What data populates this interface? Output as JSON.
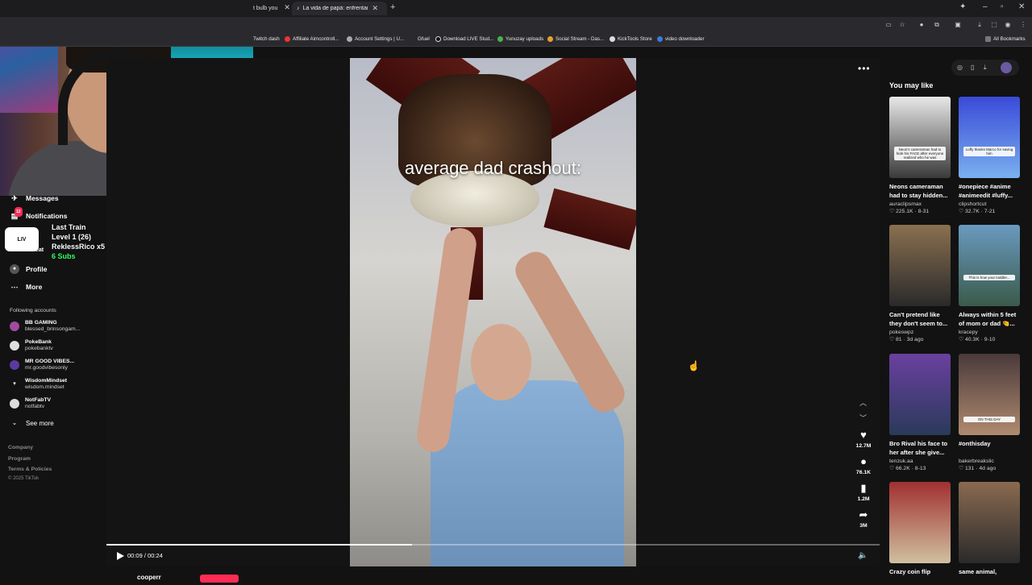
{
  "browser": {
    "tabs": [
      {
        "title": "t bulb you"
      },
      {
        "title": "La vida de papá: enfrentando o"
      }
    ],
    "bookmarks": [
      {
        "label": "Twitch dash"
      },
      {
        "label": "Affiliate Aimcontroll..."
      },
      {
        "label": "Account Settings | U..."
      },
      {
        "label": "Gfuel"
      },
      {
        "label": "Download LIVE Stud..."
      },
      {
        "label": "Yunuzay uploads"
      },
      {
        "label": "Social Stream - Das..."
      },
      {
        "label": "KickTools Store"
      },
      {
        "label": "video downloader"
      }
    ],
    "all_bookmarks": "All Bookmarks"
  },
  "sidebar": {
    "items": [
      {
        "label": "Messages",
        "icon": "messages-icon"
      },
      {
        "label": "Notifications",
        "icon": "bell-icon",
        "badge": "12"
      },
      {
        "label": "Profile",
        "icon": "profile-icon"
      },
      {
        "label": "More",
        "icon": "more-icon"
      }
    ],
    "partial_label": "eat",
    "following_title": "Following accounts",
    "following": [
      {
        "name": "BB GAMING",
        "handle": "blessed_brinsongam..."
      },
      {
        "name": "PokeBank",
        "handle": "pokebanktv"
      },
      {
        "name": "MR GOOD VIBES...",
        "handle": "mr.goodvibesonly"
      },
      {
        "name": "WisdomMindset",
        "handle": "wisdom.mindset"
      },
      {
        "name": "NotFabTV",
        "handle": "notfabtv"
      }
    ],
    "see_more": "See more",
    "footer": [
      "Company",
      "Program",
      "Terms & Policies",
      "© 2025 TikTok"
    ]
  },
  "overlay": {
    "live_label": "LIV",
    "lines": [
      "Last Train",
      "Level 1  (26)",
      "ReklessRico x5",
      "6 Subs"
    ]
  },
  "video": {
    "caption": "average dad crashout:",
    "progress": 0.395,
    "time": "00:09 / 00:24",
    "actions": [
      {
        "icon": "heart-icon",
        "count": "12.7M"
      },
      {
        "icon": "comment-icon",
        "count": "76.1K"
      },
      {
        "icon": "bookmark-icon",
        "count": "1.2M"
      },
      {
        "icon": "share-icon",
        "count": "3M"
      }
    ],
    "author_partial": "cooperr"
  },
  "recommended": {
    "title": "You may like",
    "items": [
      {
        "title": "Neons cameraman had to stay hidden...",
        "user": "auraclipsmax",
        "likes": "225.1K",
        "date": "8-31",
        "thumb_text": "Neon's cameraman had to hide his FACE after everyone realized who he was",
        "colors": [
          "#e8e8e8",
          "#3a3a3a"
        ]
      },
      {
        "title": "#onepiece #anime #animeedit #luffy...",
        "user": "clipshortcut",
        "likes": "32.7K",
        "date": "7-21",
        "thumb_text": "Luffy thanks Marco for saving him",
        "colors": [
          "#3a4ad8",
          "#7ab0f0"
        ]
      },
      {
        "title": "Can't pretend like they don't seem to...",
        "user": "pokeswpz",
        "likes": "81",
        "date": "3d ago",
        "thumb_text": "",
        "colors": [
          "#8a7050",
          "#2a2a2a"
        ]
      },
      {
        "title": "Always within 5 feet of mom or dad 🤏...",
        "user": "kracepy",
        "likes": "40.3K",
        "date": "9-10",
        "thumb_text": "This is how your toddler...",
        "colors": [
          "#6a9ac0",
          "#3a5a4a"
        ]
      },
      {
        "title": "Bro Rival his face to her after she give...",
        "user": "tenzuk.aa",
        "likes": "66.2K",
        "date": "8-13",
        "thumb_text": "",
        "colors": [
          "#6a40a0",
          "#2a3a5a"
        ]
      },
      {
        "title": "#onthisday",
        "user": "bakerbreakslic",
        "likes": "131",
        "date": "4d ago",
        "thumb_text": "ON THIS DAY",
        "colors": [
          "#4a3a3a",
          "#b08a70"
        ]
      },
      {
        "title": "Crazy coin flip",
        "user": "",
        "likes": "",
        "date": "",
        "thumb_text": "",
        "colors": [
          "#a03030",
          "#d0c0a0"
        ]
      },
      {
        "title": "same animal,",
        "user": "",
        "likes": "",
        "date": "",
        "thumb_text": "",
        "colors": [
          "#8a6a50",
          "#2a2a2a"
        ]
      }
    ]
  }
}
